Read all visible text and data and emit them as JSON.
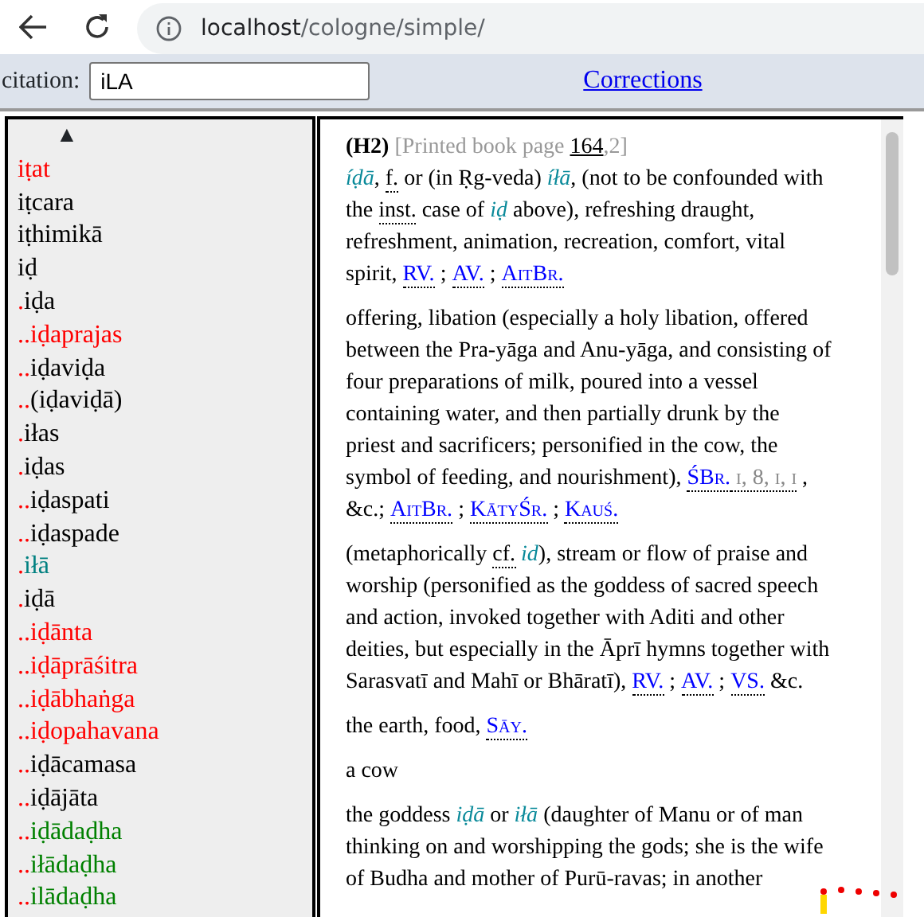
{
  "browser": {
    "url_host": "localhost",
    "url_path": "/cologne/simple/"
  },
  "toolbar": {
    "citation_label": "citation:",
    "citation_value": "iLA",
    "corrections_link": "Corrections"
  },
  "word_list": {
    "up_arrow": "▲",
    "items": [
      {
        "text": "iṭat",
        "color": "#ff0000"
      },
      {
        "text": "iṭcara",
        "color": "#000000"
      },
      {
        "text": "iṭhimikā",
        "color": "#000000"
      },
      {
        "text": "iḍ",
        "color": "#000000"
      },
      {
        "prefix": ".",
        "text": "iḍa",
        "color": "#000000"
      },
      {
        "prefix": "..",
        "text": "iḍaprajas",
        "color": "#ff0000"
      },
      {
        "prefix": "..",
        "text": "iḍaviḍa",
        "color": "#000000"
      },
      {
        "prefix": "..",
        "text": "(iḍaviḍā)",
        "color": "#000000"
      },
      {
        "prefix": ".",
        "text": "iłas",
        "color": "#000000"
      },
      {
        "prefix": ".",
        "text": "iḍas",
        "color": "#000000"
      },
      {
        "prefix": "..",
        "text": "iḍaspati",
        "color": "#000000"
      },
      {
        "prefix": "..",
        "text": "iḍaspade",
        "color": "#000000"
      },
      {
        "prefix": ".",
        "text": "iłā",
        "color": "#008080"
      },
      {
        "prefix": ".",
        "text": "iḍā",
        "color": "#000000"
      },
      {
        "prefix": "..",
        "text": "iḍānta",
        "color": "#ff0000"
      },
      {
        "prefix": "..",
        "text": "iḍāprāśitra",
        "color": "#ff0000"
      },
      {
        "prefix": "..",
        "text": "iḍābhaṅga",
        "color": "#ff0000"
      },
      {
        "prefix": "..",
        "text": "iḍopahavana",
        "color": "#ff0000"
      },
      {
        "prefix": "..",
        "text": "iḍācamasa",
        "color": "#000000"
      },
      {
        "prefix": "..",
        "text": "iḍājāta",
        "color": "#000000"
      },
      {
        "prefix": "..",
        "text": "iḍādaḍha",
        "color": "#008000"
      },
      {
        "prefix": "..",
        "text": "iłādaḍha",
        "color": "#008000"
      },
      {
        "prefix": "..",
        "text": "ilādaḍha",
        "color": "#008000"
      }
    ]
  },
  "entry": {
    "header": {
      "tag": "(H2)",
      "page_prefix": "[Printed book page ",
      "page": "164",
      "page_suffix": ",2]"
    },
    "paragraphs": [
      [
        {
          "kind": "skt",
          "text": "íḍā"
        },
        {
          "kind": "text",
          "text": ", "
        },
        {
          "kind": "abbr",
          "text": "f."
        },
        {
          "kind": "text",
          "text": " or (in Ṛg-veda) "
        },
        {
          "kind": "skt",
          "text": "íłā"
        },
        {
          "kind": "text",
          "text": ", (not to be confounded with the "
        },
        {
          "kind": "abbr",
          "text": "inst."
        },
        {
          "kind": "text",
          "text": " case of "
        },
        {
          "kind": "skt",
          "text": "iḍ"
        },
        {
          "kind": "text",
          "text": " above), refreshing draught, refreshment, animation, recreation, comfort, vital spirit, "
        },
        {
          "kind": "ref",
          "text": "RV."
        },
        {
          "kind": "text",
          "text": " ; "
        },
        {
          "kind": "ref",
          "text": "AV."
        },
        {
          "kind": "text",
          "text": " ; "
        },
        {
          "kind": "ref",
          "text": "AitBr."
        }
      ],
      [
        {
          "kind": "text",
          "text": "offering, libation (especially a holy libation, offered between the Pra-yāga and Anu-yāga, and consisting of four preparations of milk, poured into a vessel containing water, and then partially drunk by the priest and sacrificers; personified in the cow, the symbol of feeding, and nourishment), "
        },
        {
          "kind": "ref",
          "text": "ŚBr."
        },
        {
          "kind": "grey",
          "text": " i, 8, i, i"
        },
        {
          "kind": "text",
          "text": " , &c.; "
        },
        {
          "kind": "ref",
          "text": "AitBr."
        },
        {
          "kind": "text",
          "text": " ; "
        },
        {
          "kind": "ref",
          "text": "KātyŚr."
        },
        {
          "kind": "text",
          "text": " ; "
        },
        {
          "kind": "ref",
          "text": "Kauś."
        }
      ],
      [
        {
          "kind": "text",
          "text": "(metaphorically "
        },
        {
          "kind": "abbr",
          "text": "cf."
        },
        {
          "kind": "skt",
          "text": " id"
        },
        {
          "kind": "text",
          "text": "), stream or flow of praise and worship (personified as the goddess of sacred speech and action, invoked together with Aditi and other deities, but especially in the Āprī hymns together with Sarasvatī and Mahī or Bhāratī), "
        },
        {
          "kind": "ref",
          "text": "RV."
        },
        {
          "kind": "text",
          "text": " ; "
        },
        {
          "kind": "ref",
          "text": "AV."
        },
        {
          "kind": "text",
          "text": " ; "
        },
        {
          "kind": "ref",
          "text": "VS."
        },
        {
          "kind": "text",
          "text": " &c."
        }
      ],
      [
        {
          "kind": "text",
          "text": "the earth, food, "
        },
        {
          "kind": "ref",
          "text": "Sāy."
        }
      ],
      [
        {
          "kind": "text",
          "text": "a cow"
        }
      ],
      [
        {
          "kind": "text",
          "text": "the goddess "
        },
        {
          "kind": "skt",
          "text": "iḍā"
        },
        {
          "kind": "text",
          "text": " or "
        },
        {
          "kind": "skt",
          "text": "iłā"
        },
        {
          "kind": "text",
          "text": " (daughter of Manu or of man thinking on and worshipping the gods; she is the wife of Budha and mother of Purū-ravas; in another"
        }
      ]
    ]
  }
}
